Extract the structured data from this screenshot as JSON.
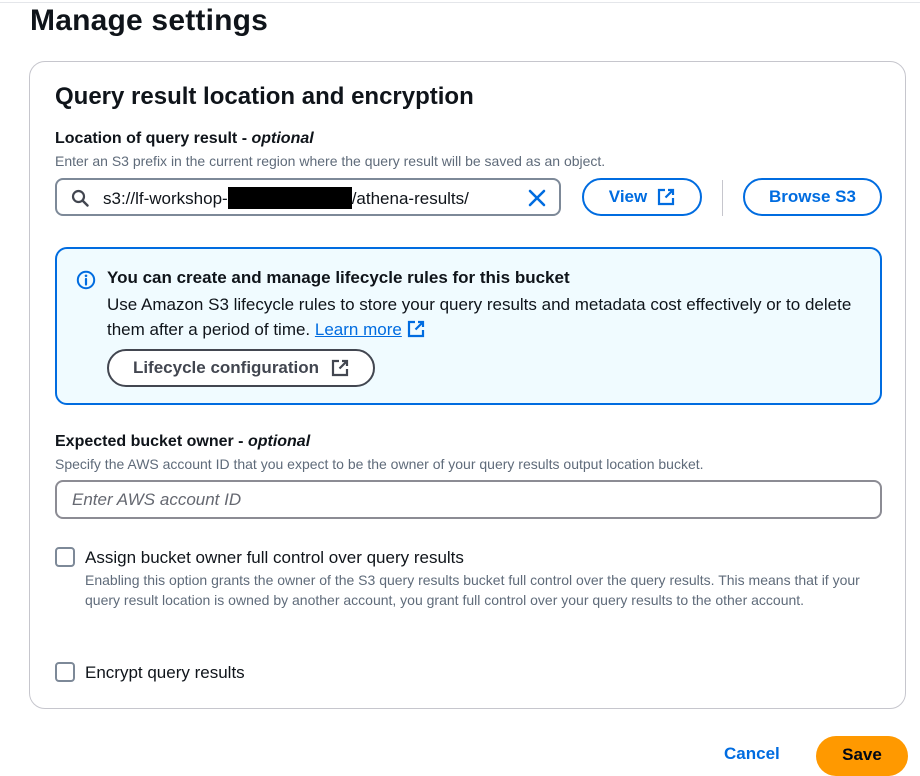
{
  "page": {
    "title": "Manage settings"
  },
  "section": {
    "title": "Query result location and encryption"
  },
  "query_location": {
    "label": "Location of query result - ",
    "optional": "optional",
    "description": "Enter an S3 prefix in the current region where the query result will be saved as an object.",
    "value_prefix": "s3://lf-workshop-",
    "value_suffix": "/athena-results/",
    "view_label": "View",
    "browse_label": "Browse S3"
  },
  "info_alert": {
    "title": "You can create and manage lifecycle rules for this bucket",
    "body": "Use Amazon S3 lifecycle rules to store your query results and metadata cost effectively or to delete them after a period of time.",
    "link": "Learn more",
    "button": "Lifecycle configuration"
  },
  "bucket_owner": {
    "label": "Expected bucket owner - ",
    "optional": "optional",
    "description": "Specify the AWS account ID that you expect to be the owner of your query results output location bucket.",
    "placeholder": "Enter AWS account ID",
    "value": ""
  },
  "full_control": {
    "label": "Assign bucket owner full control over query results",
    "description": "Enabling this option grants the owner of the S3 query results bucket full control over the query results. This means that if your query result location is owned by another account, you grant full control over your query results to the other account.",
    "checked": false
  },
  "encrypt": {
    "label": "Encrypt query results",
    "checked": false
  },
  "footer": {
    "cancel": "Cancel",
    "save": "Save"
  },
  "colors": {
    "link": "#006ce0",
    "primary": "#ff9900",
    "info_bg": "#f0fbff",
    "text": "#0f141a",
    "muted": "#5f6b7a"
  },
  "icons": {
    "search": "search-icon",
    "clear": "close-icon",
    "external": "external-link-icon",
    "info": "info-icon"
  }
}
